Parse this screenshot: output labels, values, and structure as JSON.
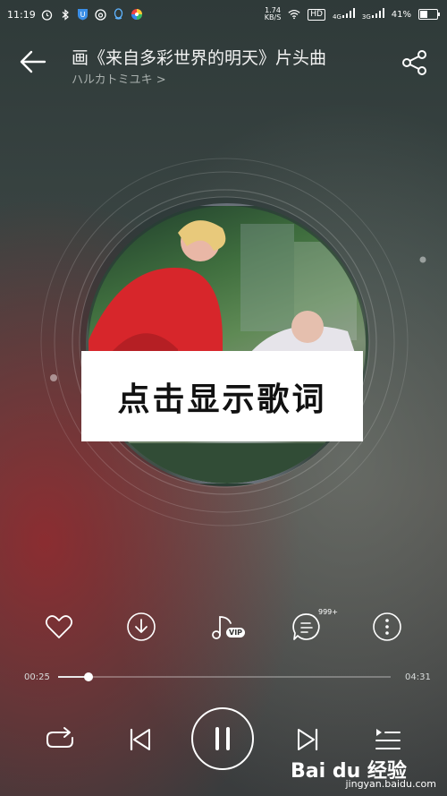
{
  "status_bar": {
    "time": "11:19",
    "net_speed": "1.74",
    "net_unit": "KB/S",
    "hd": "HD",
    "sig1": "4G",
    "sig2": "3G",
    "battery": "41%"
  },
  "header": {
    "title": "画《来自多彩世界的明天》片头曲",
    "artist": "ハルカトミユキ >",
    "back_icon": "arrow-left-icon",
    "share_icon": "share-icon"
  },
  "overlay": {
    "lyric_prompt": "点击显示歌词"
  },
  "actions": {
    "items": [
      "heart-icon",
      "download-icon",
      "music-vip-icon",
      "comment-icon",
      "more-icon"
    ],
    "vip_badge": "VIP",
    "comment_count": "999+"
  },
  "progress": {
    "current": "00:25",
    "total": "04:31",
    "fraction": 0.092
  },
  "playback": {
    "items": [
      "repeat-icon",
      "previous-icon",
      "pause-icon",
      "next-icon",
      "playlist-icon"
    ]
  },
  "watermark": {
    "main": "Bai du 经验",
    "sub": "jingyan.baidu.com"
  }
}
